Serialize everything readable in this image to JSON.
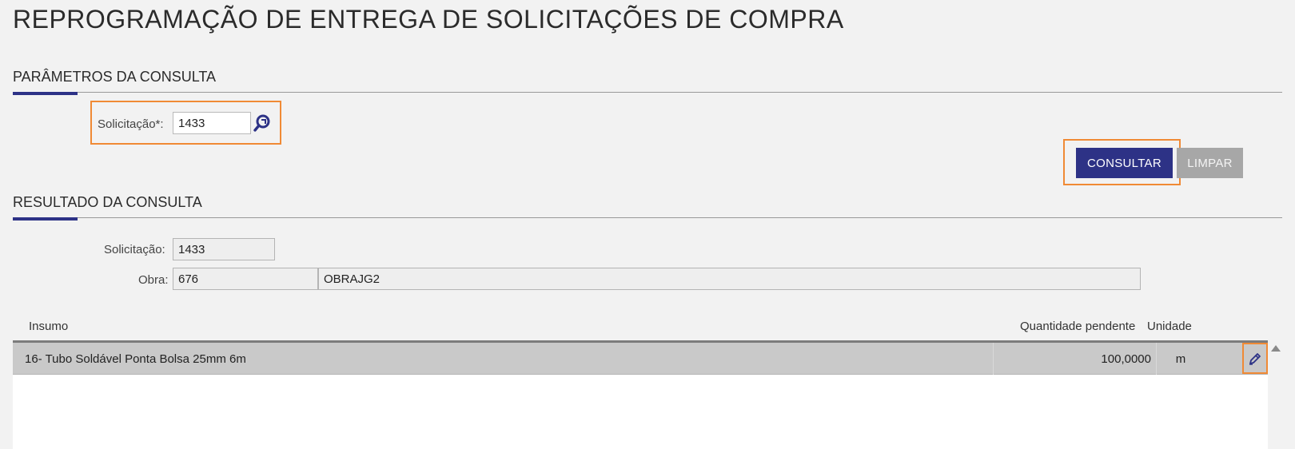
{
  "page": {
    "title": "REPROGRAMAÇÃO DE ENTREGA DE SOLICITAÇÕES DE COMPRA"
  },
  "parametros": {
    "title": "PARÂMETROS DA CONSULTA",
    "solicitacao_label": "Solicitação*:",
    "solicitacao_value": "1433",
    "lookup_icon": "search-lookup-icon"
  },
  "actions": {
    "consultar_label": "CONSULTAR",
    "limpar_label": "LIMPAR"
  },
  "resultado": {
    "title": "RESULTADO DA CONSULTA",
    "solicitacao_label": "Solicitação:",
    "solicitacao_value": "1433",
    "obra_label": "Obra:",
    "obra_code": "676",
    "obra_name": "OBRAJG2"
  },
  "table": {
    "columns": {
      "insumo": "Insumo",
      "quantidade": "Quantidade pendente",
      "unidade": "Unidade"
    },
    "rows": [
      {
        "insumo": "16- Tubo Soldável Ponta Bolsa 25mm 6m",
        "quantidade": "100,0000",
        "unidade": "m",
        "action_icon": "pencil-edit-icon"
      }
    ]
  },
  "colors": {
    "primary": "#2d3286",
    "highlight": "#f08a35",
    "secondary_button": "#a7a7a7"
  }
}
